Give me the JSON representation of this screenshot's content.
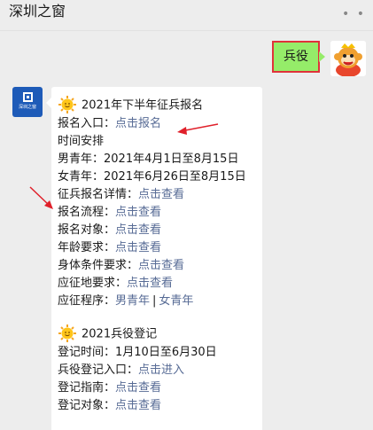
{
  "header": {
    "title": "深圳之窗",
    "more_icon": "more-dots-icon"
  },
  "sent_message": {
    "text": "兵役"
  },
  "bot": {
    "avatar_text": "深圳之窗"
  },
  "section1": {
    "heading": "2021年下半年征兵报名",
    "entry_label": "报名入口：",
    "entry_link": "点击报名",
    "schedule_title": "时间安排",
    "male_label": "男青年：",
    "male_dates": "2021年4月1日至8月15日",
    "female_label": "女青年：",
    "female_dates": "2021年6月26日至8月15日",
    "details_label": "征兵报名详情：",
    "details_link": "点击查看",
    "process_label": "报名流程：",
    "process_link": "点击查看",
    "target_label": "报名对象：",
    "target_link": "点击查看",
    "age_label": "年龄要求：",
    "age_link": "点击查看",
    "physical_label": "身体条件要求：",
    "physical_link": "点击查看",
    "location_label": "应征地要求：",
    "location_link": "点击查看",
    "procedure_label": "应征程序：",
    "procedure_male_link": "男青年",
    "procedure_sep": "|",
    "procedure_female_link": "女青年"
  },
  "section2": {
    "heading": "2021兵役登记",
    "time_label": "登记时间：",
    "time_value": "1月10日至6月30日",
    "entry_label": "兵役登记入口：",
    "entry_link": "点击进入",
    "guide_label": "登记指南：",
    "guide_link": "点击查看",
    "target_label": "登记对象：",
    "target_link": "点击查看"
  },
  "colors": {
    "sent_bubble": "#95ec69",
    "highlight_border": "#e0323a",
    "link": "#576b95",
    "annotation_arrow": "#e0202a"
  }
}
